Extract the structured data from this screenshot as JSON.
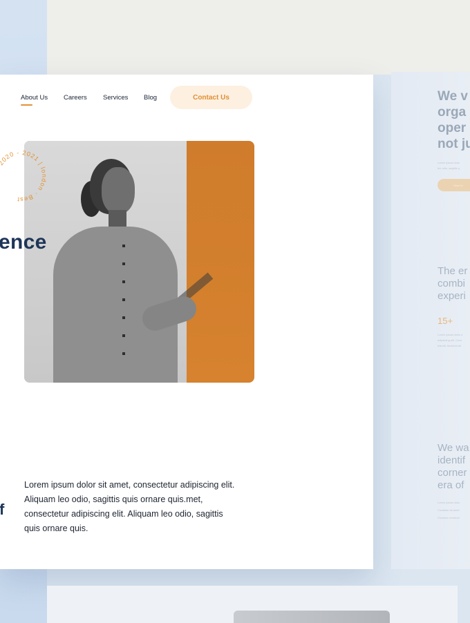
{
  "nav": {
    "items": [
      "About Us",
      "Careers",
      "Services",
      "Blog"
    ],
    "contact_label": "Contact Us"
  },
  "hero": {
    "badge_text": "2020 - 2021 | london · Best ",
    "word_fragment": "ence",
    "letter_fragment": "f",
    "paragraph": "Lorem ipsum dolor sit amet, consectetur adipiscing elit. Aliquam leo odio, sagittis quis ornare quis.met, consectetur adipiscing elit. Aliquam leo odio, sagittis quis ornare quis."
  },
  "right_card": {
    "heading_lines": [
      "We v",
      "orga",
      "oper",
      "not ju"
    ],
    "tiny_top": [
      "Lorem ipsum dolo",
      "leo odio, sagittis q"
    ],
    "button_label": "More in",
    "subhead_1": [
      "The er",
      "combi",
      "experi"
    ],
    "stat_value": "15+",
    "tiny_mid": [
      "Lorem ipsum dolor s",
      "adipiscing elit. Cura",
      "blandit, tincidunt ali"
    ],
    "subhead_2": [
      "We wa",
      "identif",
      "corner",
      "era of"
    ],
    "tiny_bottom": [
      "Lorem ipsum dolo",
      "Curabitur sit amet",
      "Vivamus commod"
    ]
  },
  "colors": {
    "accent": "#e29236",
    "accent_soft": "#fdf0e1",
    "navy": "#1d3557",
    "photo_orange": "#d6822e"
  }
}
